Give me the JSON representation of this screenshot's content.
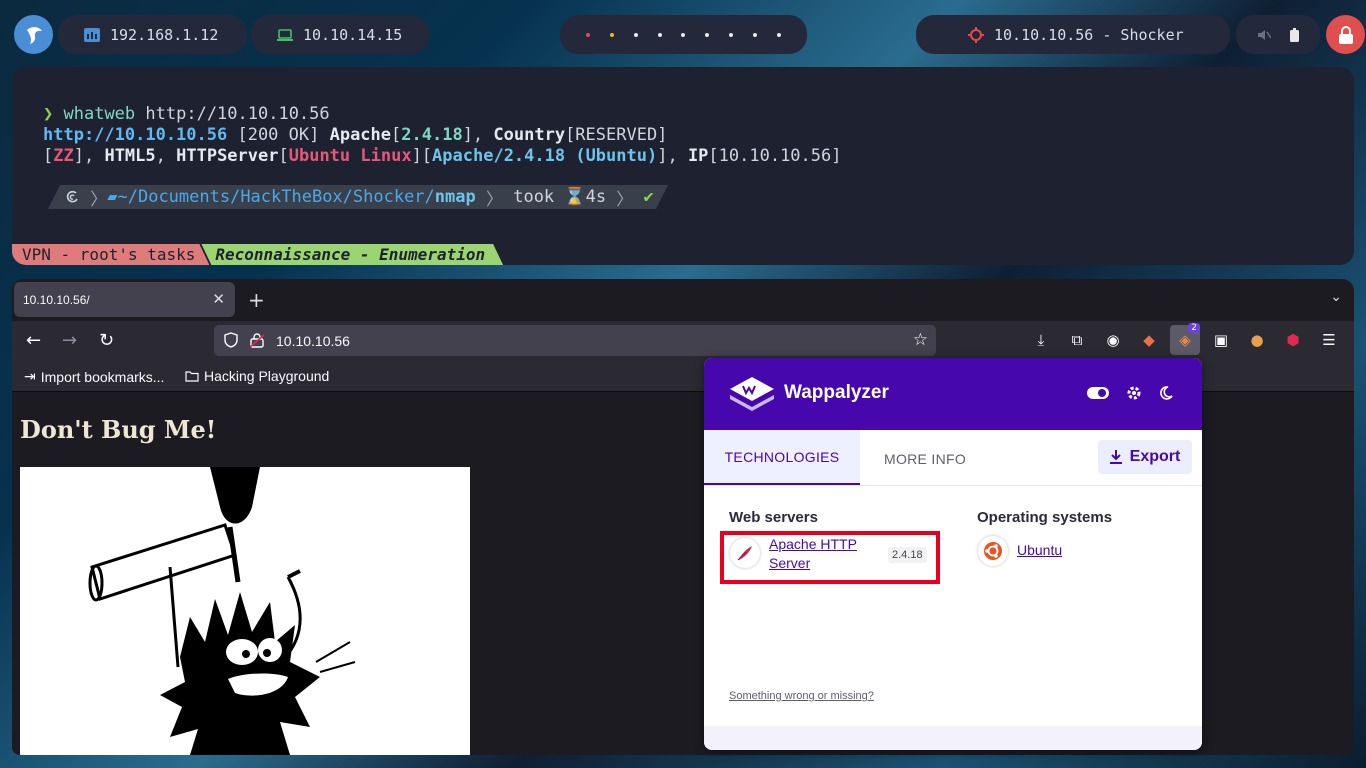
{
  "topbar": {
    "ip_local": "192.168.1.12",
    "ip_vpn": "10.10.14.15",
    "target": "10.10.10.56 - Shocker",
    "workspace_dot_colors": [
      "#e84a4a",
      "#f0b429",
      "#e8e8e8",
      "#e8e8e8",
      "#e8e8e8",
      "#e8e8e8",
      "#e8e8e8",
      "#e8e8e8",
      "#e8e8e8"
    ]
  },
  "terminal": {
    "prompt_symbol": "❯",
    "command": "whatweb",
    "command_arg": "http://10.10.10.56",
    "out1_url": "http://10.10.10.56",
    "out1_status": " [200 OK] ",
    "out1_apache": "Apache",
    "out1_br1": "[",
    "out1_ver": "2.4.18",
    "out1_br2": "], ",
    "out1_country": "Country",
    "out1_country_val": "[RESERVED]",
    "out2_br1": "[",
    "out2_zz": "ZZ",
    "out2_br2": "], ",
    "out2_html5": "HTML5",
    "out2_comma": ", ",
    "out2_httpserver": "HTTPServer",
    "out2_br3": "[",
    "out2_os": "Ubuntu Linux",
    "out2_br4": "][",
    "out2_server": "Apache/2.4.18 (Ubuntu)",
    "out2_br5": "], ",
    "out2_ip": "IP",
    "out2_ip_val": "[10.10.10.56]",
    "path_prefix": "~/Documents/HackTheBox/Shocker/",
    "path_last": "nmap",
    "took_label": "took",
    "took_value": "4s",
    "check": "✔",
    "tmux_session": "VPN - root's tasks",
    "tmux_window": "Reconnaissance - Enumeration"
  },
  "browser": {
    "tab_title": "10.10.10.56/",
    "url": "10.10.10.56",
    "bookmarks": [
      "Import bookmarks...",
      "Hacking Playground"
    ],
    "extension_badge": "2"
  },
  "page": {
    "heading": "Don't Bug Me!"
  },
  "wappalyzer": {
    "title": "Wappalyzer",
    "tabs": [
      "TECHNOLOGIES",
      "MORE INFO"
    ],
    "export_label": "Export",
    "categories": [
      {
        "name": "Web servers",
        "tech": "Apache HTTP Server",
        "tech_line1": "Apache HTTP",
        "tech_line2": "Server",
        "version": "2.4.18"
      },
      {
        "name": "Operating systems",
        "tech": "Ubuntu"
      }
    ],
    "footer_link": "Something wrong or missing?",
    "brand_color": "#4608ad"
  }
}
